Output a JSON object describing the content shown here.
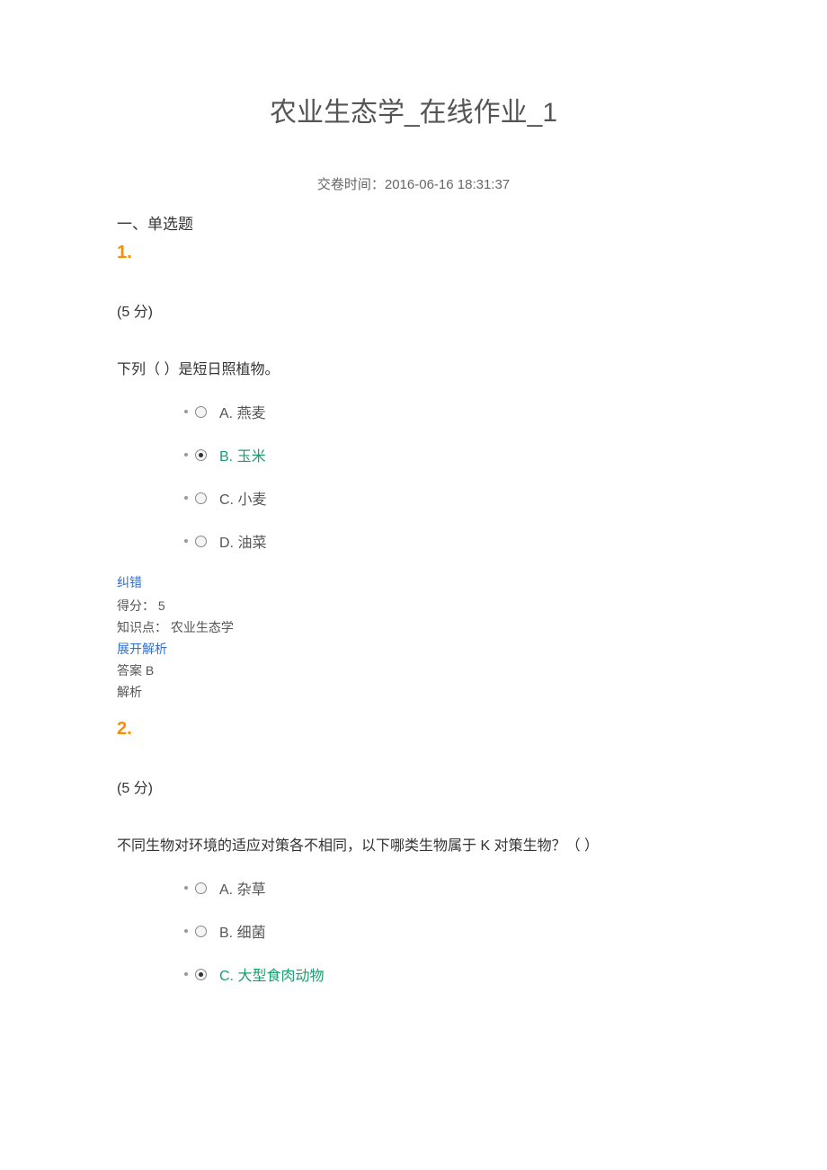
{
  "title": "农业生态学_在线作业_1",
  "submit_time_label": "交卷时间：",
  "submit_time_value": "2016-06-16 18:31:37",
  "section_heading": "一、单选题",
  "questions": [
    {
      "number": "1.",
      "points": "(5 分)",
      "text": "下列（ ）是短日照植物。",
      "options": [
        {
          "letter": "A.",
          "text": "燕麦",
          "selected": false,
          "correct": false
        },
        {
          "letter": "B.",
          "text": "玉米",
          "selected": true,
          "correct": true
        },
        {
          "letter": "C.",
          "text": "小麦",
          "selected": false,
          "correct": false
        },
        {
          "letter": "D.",
          "text": "油菜",
          "selected": false,
          "correct": false
        }
      ],
      "correction": "纠错",
      "score_label": "得分：",
      "score_value": "5",
      "kpoint_label": "知识点：",
      "kpoint_value": "农业生态学",
      "expand": "展开解析",
      "answer_label": "答案",
      "answer_value": "B",
      "analysis_label": "解析"
    },
    {
      "number": "2.",
      "points": "(5 分)",
      "text": "不同生物对环境的适应对策各不相同，以下哪类生物属于 K 对策生物？（ ）",
      "options": [
        {
          "letter": "A.",
          "text": "杂草",
          "selected": false,
          "correct": false
        },
        {
          "letter": "B.",
          "text": "细菌",
          "selected": false,
          "correct": false
        },
        {
          "letter": "C.",
          "text": "大型食肉动物",
          "selected": true,
          "correct": true
        }
      ]
    }
  ]
}
